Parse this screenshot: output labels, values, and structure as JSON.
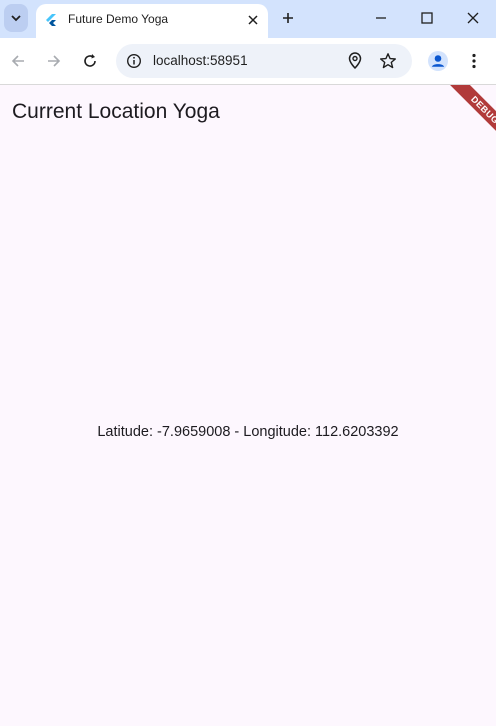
{
  "browser": {
    "tab_title": "Future Demo Yoga",
    "url": "localhost:58951"
  },
  "app": {
    "title": "Current Location Yoga",
    "location_text": "Latitude: -7.9659008 - Longitude: 112.6203392",
    "debug_banner": "DEBUG"
  },
  "colors": {
    "tabstrip": "#d3e3fd",
    "page_background": "#fdf7fe",
    "debug_banner": "#b13a3a"
  }
}
